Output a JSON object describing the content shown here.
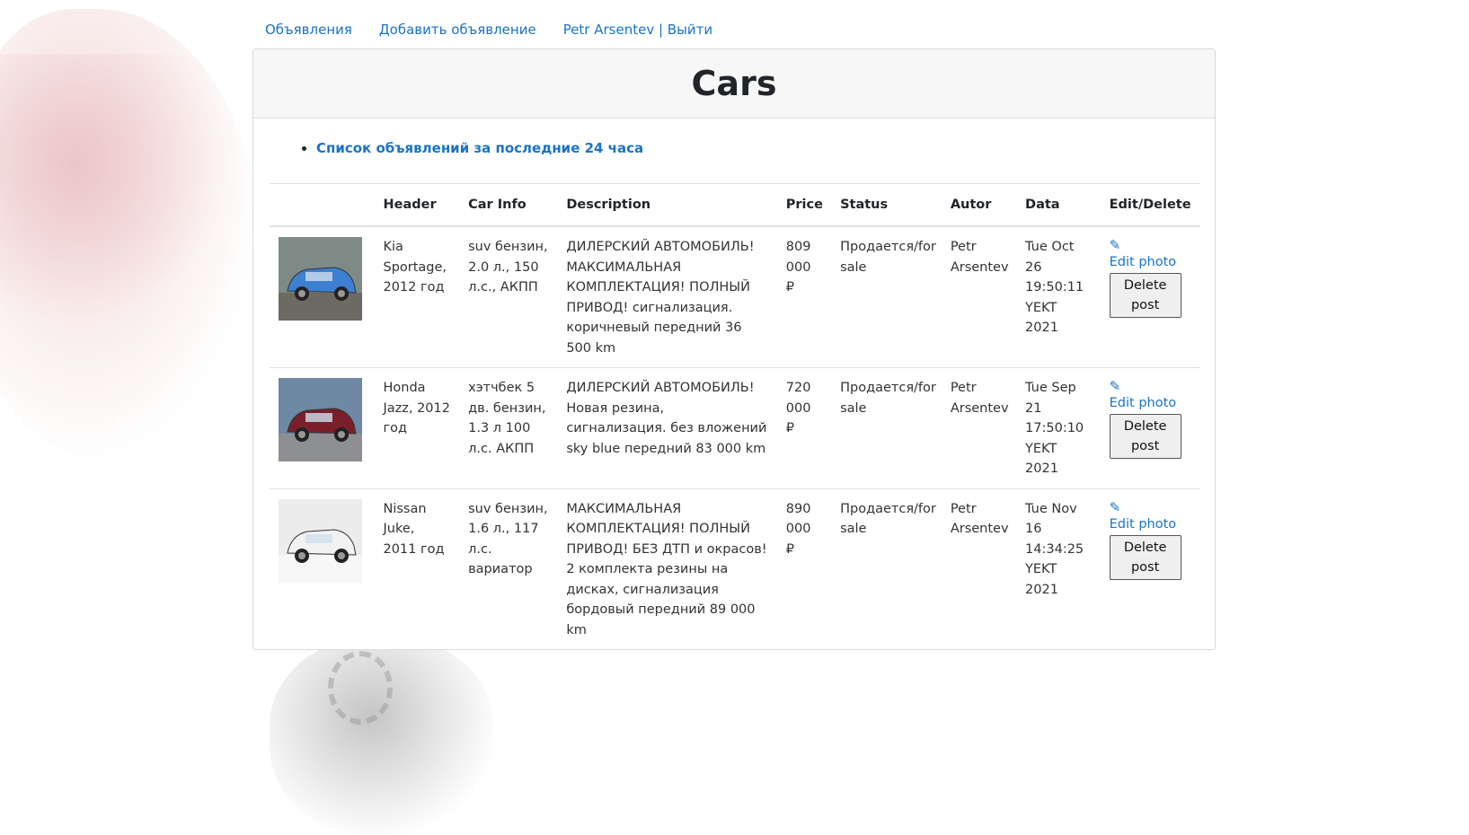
{
  "nav": {
    "ads": "Объявления",
    "add_ad": "Добавить объявление",
    "user_logout": "Petr Arsentev | Выйти"
  },
  "page": {
    "title": "Cars",
    "last24_link": "Список объявлений за последние 24 часа"
  },
  "table": {
    "headers": {
      "header": "Header",
      "car_info": "Car Info",
      "description": "Description",
      "price": "Price",
      "status": "Status",
      "autor": "Autor",
      "data": "Data",
      "edit_delete": "Edit/Delete"
    },
    "edit_photo_label": "Edit photo",
    "delete_label": "Delete post",
    "rows": [
      {
        "header": "Kia Sportage, 2012 год",
        "car_info": "suv бензин, 2.0 л., 150 л.с., АКПП",
        "description": "ДИЛЕРСКИЙ АВТОМОБИЛЬ! МАКСИМАЛЬНАЯ КОМПЛЕКТАЦИЯ! ПОЛНЫЙ ПРИВОД! сигнализация. коричневый передний 36 500 km",
        "price": "809 000 ₽",
        "status": "Продается/for sale",
        "autor": "Petr Arsentev",
        "data": "Tue Oct 26 19:50:11 YEKT 2021",
        "car_color": "#3d7fd0"
      },
      {
        "header": "Honda Jazz, 2012 год",
        "car_info": "хэтчбек 5 дв. бензин, 1.3 л 100 л.с. АКПП",
        "description": "ДИЛЕРСКИЙ АВТОМОБИЛЬ! Новая резина, сигнализация. без вложений sky blue передний 83 000 km",
        "price": "720 000 ₽",
        "status": "Продается/for sale",
        "autor": "Petr Arsentev",
        "data": "Tue Sep 21 17:50:10 YEKT 2021",
        "car_color": "#7a1f2a"
      },
      {
        "header": "Nissan Juke, 2011 год",
        "car_info": "suv бензин, 1.6 л., 117 л.с. вариатор",
        "description": "МАКСИМАЛЬНАЯ КОМПЛЕКТАЦИЯ! ПОЛНЫЙ ПРИВОД! БЕЗ ДТП и окрасов! 2 комплекта резины на дисках, сигнализация бордовый передний 89 000 km",
        "price": "890 000 ₽",
        "status": "Продается/for sale",
        "autor": "Petr Arsentev",
        "data": "Tue Nov 16 14:34:25 YEKT 2021",
        "car_color": "#f2f2f2"
      }
    ]
  }
}
